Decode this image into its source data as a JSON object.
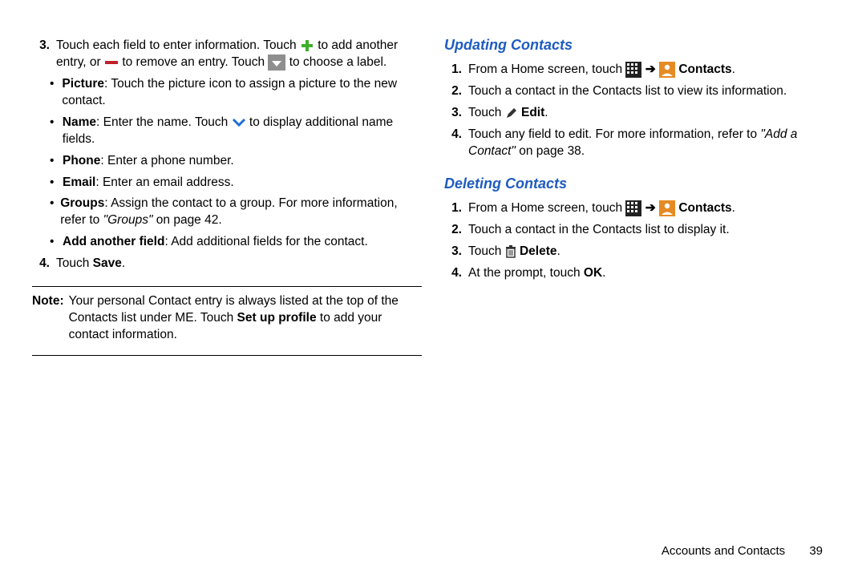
{
  "left": {
    "step3": {
      "num": "3.",
      "t1": "Touch each field to enter information. Touch ",
      "t2": " to add another entry, or ",
      "t3": " to remove an entry. Touch ",
      "t4": " to choose a label."
    },
    "bullets": {
      "picture": {
        "term": "Picture",
        "rest": ": Touch the picture icon to assign a picture to the new contact."
      },
      "name1": {
        "term": "Name",
        "rest1": ": Enter the name. Touch ",
        "rest2": " to display additional name fields."
      },
      "phone": {
        "term": "Phone",
        "rest": ": Enter a phone number."
      },
      "email": {
        "term": "Email",
        "rest": ": Enter an email address."
      },
      "groups": {
        "term": "Groups",
        "rest1": ": Assign the contact to a group. For more information, refer to ",
        "ref": "\"Groups\"",
        "rest2": " on page 42."
      },
      "add": {
        "term": "Add another field",
        "rest": ": Add additional fields for the contact."
      }
    },
    "step4": {
      "num": "4.",
      "t1": "Touch ",
      "b": "Save",
      "t2": "."
    },
    "note": {
      "label": "Note:",
      "t1": " Your personal Contact entry is always listed at the top of the Contacts list under ME. Touch ",
      "b": "Set up profile",
      "t2": " to add your contact information."
    }
  },
  "right": {
    "h_update": "Updating Contacts",
    "u1": {
      "num": "1.",
      "t1": "From a Home screen, touch ",
      "arrow": " ➔ ",
      "b": "Contacts",
      "t2": "."
    },
    "u2": {
      "num": "2.",
      "t": "Touch a contact in the Contacts list to view its information."
    },
    "u3": {
      "num": "3.",
      "t1": "Touch ",
      "b": "Edit",
      "t2": "."
    },
    "u4": {
      "num": "4.",
      "t1": "Touch any field to edit. For more information, refer to ",
      "ref": "\"Add a Contact\"",
      "t2": " on page 38."
    },
    "h_delete": "Deleting Contacts",
    "d1": {
      "num": "1.",
      "t1": "From a Home screen, touch ",
      "arrow": " ➔ ",
      "b": "Contacts",
      "t2": "."
    },
    "d2": {
      "num": "2.",
      "t": "Touch a contact in the Contacts list to display it."
    },
    "d3": {
      "num": "3.",
      "t1": "Touch ",
      "b": "Delete",
      "t2": "."
    },
    "d4": {
      "num": "4.",
      "t1": "At the prompt, touch ",
      "b": "OK",
      "t2": "."
    }
  },
  "footer": {
    "section": "Accounts and Contacts",
    "page": "39"
  }
}
